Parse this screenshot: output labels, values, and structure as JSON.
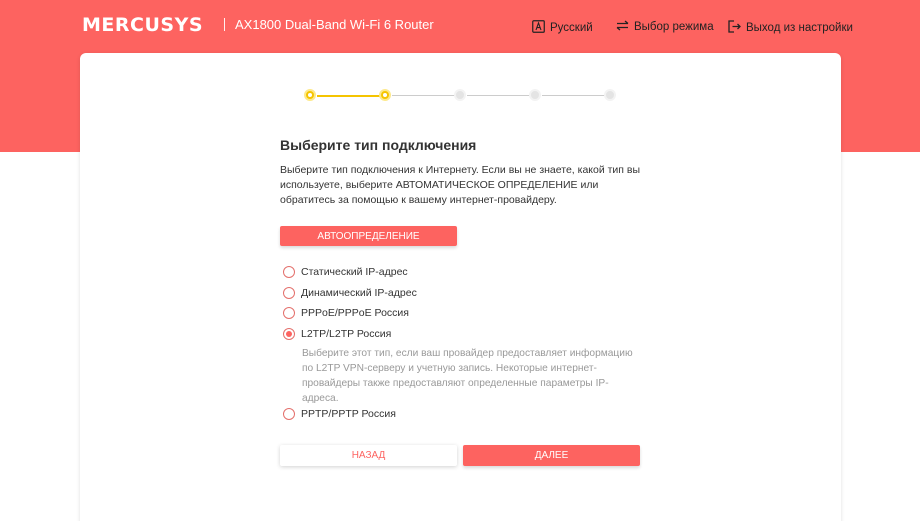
{
  "header": {
    "logo": "MERCUSYS",
    "model": "AX1800 Dual-Band Wi-Fi 6 Router",
    "language_label": "Русский",
    "mode_label": "Выбор режима",
    "exit_label": "Выход из настройки"
  },
  "stepper": {
    "total_steps": 5,
    "completed_steps": 2
  },
  "main": {
    "title": "Выберите тип подключения",
    "description": "Выберите тип подключения к Интернету. Если вы не знаете, какой тип вы используете, выберите АВТОМАТИЧЕСКОЕ ОПРЕДЕЛЕНИЕ или обратитесь за помощью к вашему интернет-провайдеру.",
    "auto_detect_label": "АВТООПРЕДЕЛЕНИЕ",
    "options": [
      {
        "label": "Статический IP-адрес",
        "checked": false
      },
      {
        "label": "Динамический IP-адрес",
        "checked": false
      },
      {
        "label": "PPPoE/PPPoE Россия",
        "checked": false
      },
      {
        "label": "L2TP/L2TP Россия",
        "checked": true
      },
      {
        "label": "PPTP/PPTP Россия",
        "checked": false
      }
    ],
    "selected_hint": "Выберите этот тип, если ваш провайдер предоставляет информацию по L2TP VPN-серверу и учетную запись. Некоторые интернет-провайдеры также предоставляют определенные параметры IP-адреса.",
    "back_label": "НАЗАД",
    "next_label": "ДАЛЕЕ"
  },
  "colors": {
    "brand": "#fd6360",
    "step_active": "#f5c400",
    "step_inactive": "#e4e4e4"
  }
}
